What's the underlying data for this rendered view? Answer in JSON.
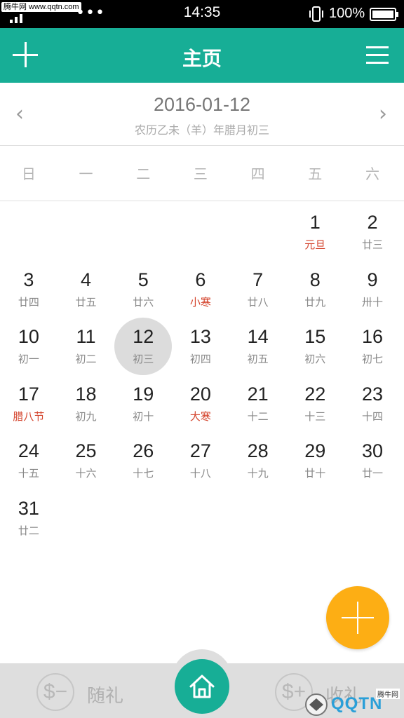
{
  "status_bar": {
    "watermark": "腾牛网 www.qqtn.com",
    "dots": "•••",
    "time": "14:35",
    "battery": "100%"
  },
  "header": {
    "title": "主页",
    "add_icon": "plus-icon",
    "menu_icon": "hamburger-menu-icon"
  },
  "date_nav": {
    "prev": "‹",
    "next": "›",
    "date": "2016-01-12",
    "lunar": "农历乙未（羊）年腊月初三"
  },
  "weekdays": [
    "日",
    "一",
    "二",
    "三",
    "四",
    "五",
    "六"
  ],
  "calendar": {
    "selected_day": "12",
    "weeks": [
      [
        null,
        null,
        null,
        null,
        null,
        {
          "day": "1",
          "sub": "元旦",
          "holiday": true
        },
        {
          "day": "2",
          "sub": "廿三"
        }
      ],
      [
        {
          "day": "3",
          "sub": "廿四"
        },
        {
          "day": "4",
          "sub": "廿五"
        },
        {
          "day": "5",
          "sub": "廿六"
        },
        {
          "day": "6",
          "sub": "小寒",
          "holiday": true
        },
        {
          "day": "7",
          "sub": "廿八"
        },
        {
          "day": "8",
          "sub": "廿九"
        },
        {
          "day": "9",
          "sub": "卅十"
        }
      ],
      [
        {
          "day": "10",
          "sub": "初一"
        },
        {
          "day": "11",
          "sub": "初二"
        },
        {
          "day": "12",
          "sub": "初三",
          "selected": true
        },
        {
          "day": "13",
          "sub": "初四"
        },
        {
          "day": "14",
          "sub": "初五"
        },
        {
          "day": "15",
          "sub": "初六"
        },
        {
          "day": "16",
          "sub": "初七"
        }
      ],
      [
        {
          "day": "17",
          "sub": "腊八节",
          "holiday": true
        },
        {
          "day": "18",
          "sub": "初九"
        },
        {
          "day": "19",
          "sub": "初十"
        },
        {
          "day": "20",
          "sub": "大寒",
          "holiday": true
        },
        {
          "day": "21",
          "sub": "十二"
        },
        {
          "day": "22",
          "sub": "十三"
        },
        {
          "day": "23",
          "sub": "十四"
        }
      ],
      [
        {
          "day": "24",
          "sub": "十五"
        },
        {
          "day": "25",
          "sub": "十六"
        },
        {
          "day": "26",
          "sub": "十七"
        },
        {
          "day": "27",
          "sub": "十八"
        },
        {
          "day": "28",
          "sub": "十九"
        },
        {
          "day": "29",
          "sub": "廿十"
        },
        {
          "day": "30",
          "sub": "廿一"
        }
      ],
      [
        {
          "day": "31",
          "sub": "廿二"
        },
        null,
        null,
        null,
        null,
        null,
        null
      ]
    ]
  },
  "bottom_bar": {
    "left_symbol": "$−",
    "left_label": "随礼",
    "right_symbol": "$+",
    "right_label": "收礼",
    "home_icon": "home-icon"
  },
  "watermark_logo": {
    "text": "QQTN",
    "small": "腾牛网"
  },
  "colors": {
    "accent": "#17ae96",
    "fab": "#fdae14",
    "holiday_red": "#d4452e"
  }
}
